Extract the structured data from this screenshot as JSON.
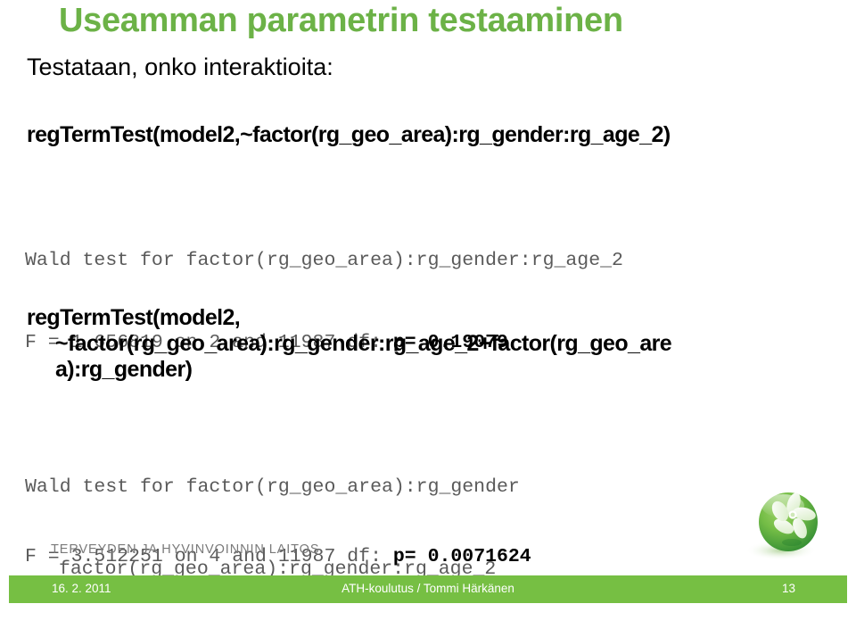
{
  "slide": {
    "title": "Useamman parametrin testaaminen",
    "subtitle": "Testataan, onko interaktioita:"
  },
  "code": {
    "formula_1": "regTermTest(model2,~factor(rg_geo_area):rg_gender:rg_age_2)",
    "formula_2_line_1": "regTermTest(model2,",
    "formula_2_line_2": "~factor(rg_geo_area):rg_gender:rg_age_2+factor(rg_geo_are",
    "formula_2_line_3": "a):rg_gender)"
  },
  "output_1": {
    "wald_line": "Wald test for factor(rg_geo_area):rg_gender:rg_age_2",
    "stat_prefix": "F = 1.656819 on 2 and 11987 df: ",
    "p_value": "p= 0.19079"
  },
  "output_2": {
    "wald_line_1": "Wald test for factor(rg_geo_area):rg_gender",
    "wald_line_2": "factor(rg_geo_area):rg_gender:rg_age_2",
    "stat_prefix": "F = 3.512251 on 4 and 11987 df: ",
    "p_value": "p= 0.0071624"
  },
  "branding": {
    "organization": "TERVEYDEN JA HYVINVOINNIN LAITOS",
    "logo_icon": "thl-sphere-flower-logo"
  },
  "footer": {
    "date": "16. 2.  2011",
    "center_text": "ATH-koulutus / Tommi Härkänen",
    "page_number": "13"
  },
  "colors": {
    "title_green": "#6cb247",
    "footer_green": "#76bf43",
    "output_gray": "#5a5a5a",
    "org_gray": "#7a7a7a"
  }
}
